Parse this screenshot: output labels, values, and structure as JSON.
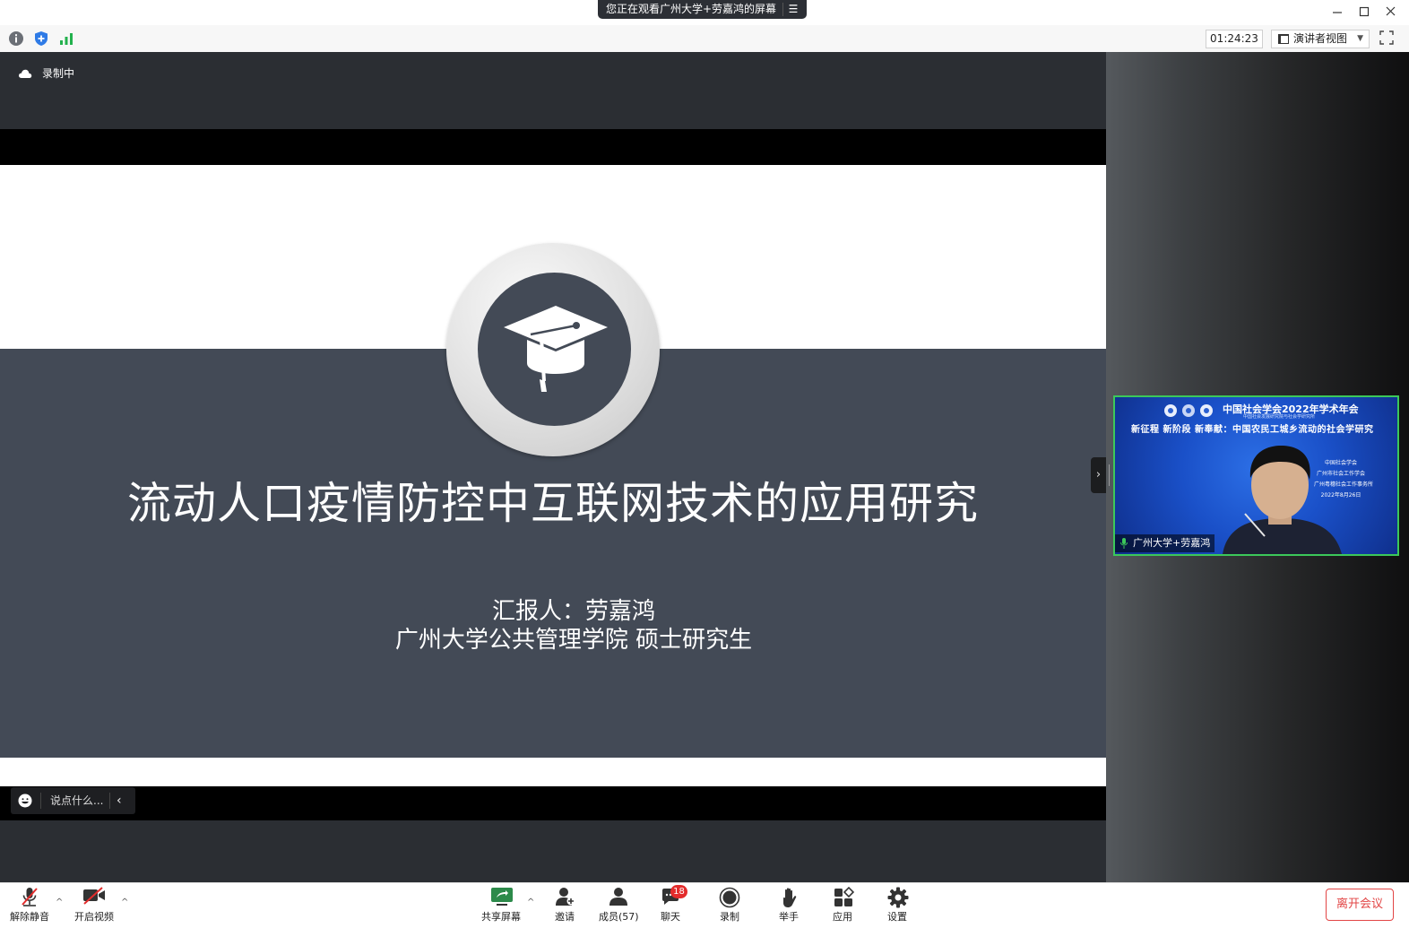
{
  "titlebar": {
    "share_notice": "您正在观看广州大学+劳嘉鸿的屏幕",
    "menu_glyph": "☰"
  },
  "toolbar": {
    "timer": "01:24:23",
    "view_mode": "演讲者视图"
  },
  "stage": {
    "recording_label": "录制中",
    "chat_placeholder": "说点什么..."
  },
  "slide": {
    "title": "流动人口疫情防控中互联网技术的应用研究",
    "presenter": "汇报人：劳嘉鸿",
    "affiliation": "广州大学公共管理学院 硕士研究生"
  },
  "video_tile": {
    "participant_name": "广州大学+劳嘉鸿",
    "bg_header": "中国社会学会2022年学术年会",
    "bg_header_sub": "中国社会发展研究院与社会学研究所",
    "bg_title": "新征程 新阶段 新奉献：中国农民工城乡流动的社会学研究",
    "bg_org1": "中国社会学会",
    "bg_org2": "广州市社会工作学会",
    "bg_org3": "广州粤穗社会工作事务所",
    "bg_date": "2022年8月26日"
  },
  "bottombar": {
    "unmute": "解除静音",
    "start_video": "开启视频",
    "share_screen": "共享屏幕",
    "invite": "邀请",
    "members": "成员(57)",
    "chat": "聊天",
    "chat_badge": "18",
    "record": "录制",
    "raise_hand": "举手",
    "apps": "应用",
    "settings": "设置",
    "leave": "离开会议"
  },
  "colors": {
    "slide_band": "#434a56",
    "accent_green": "#3cc85a",
    "leave_red": "#e24545"
  }
}
